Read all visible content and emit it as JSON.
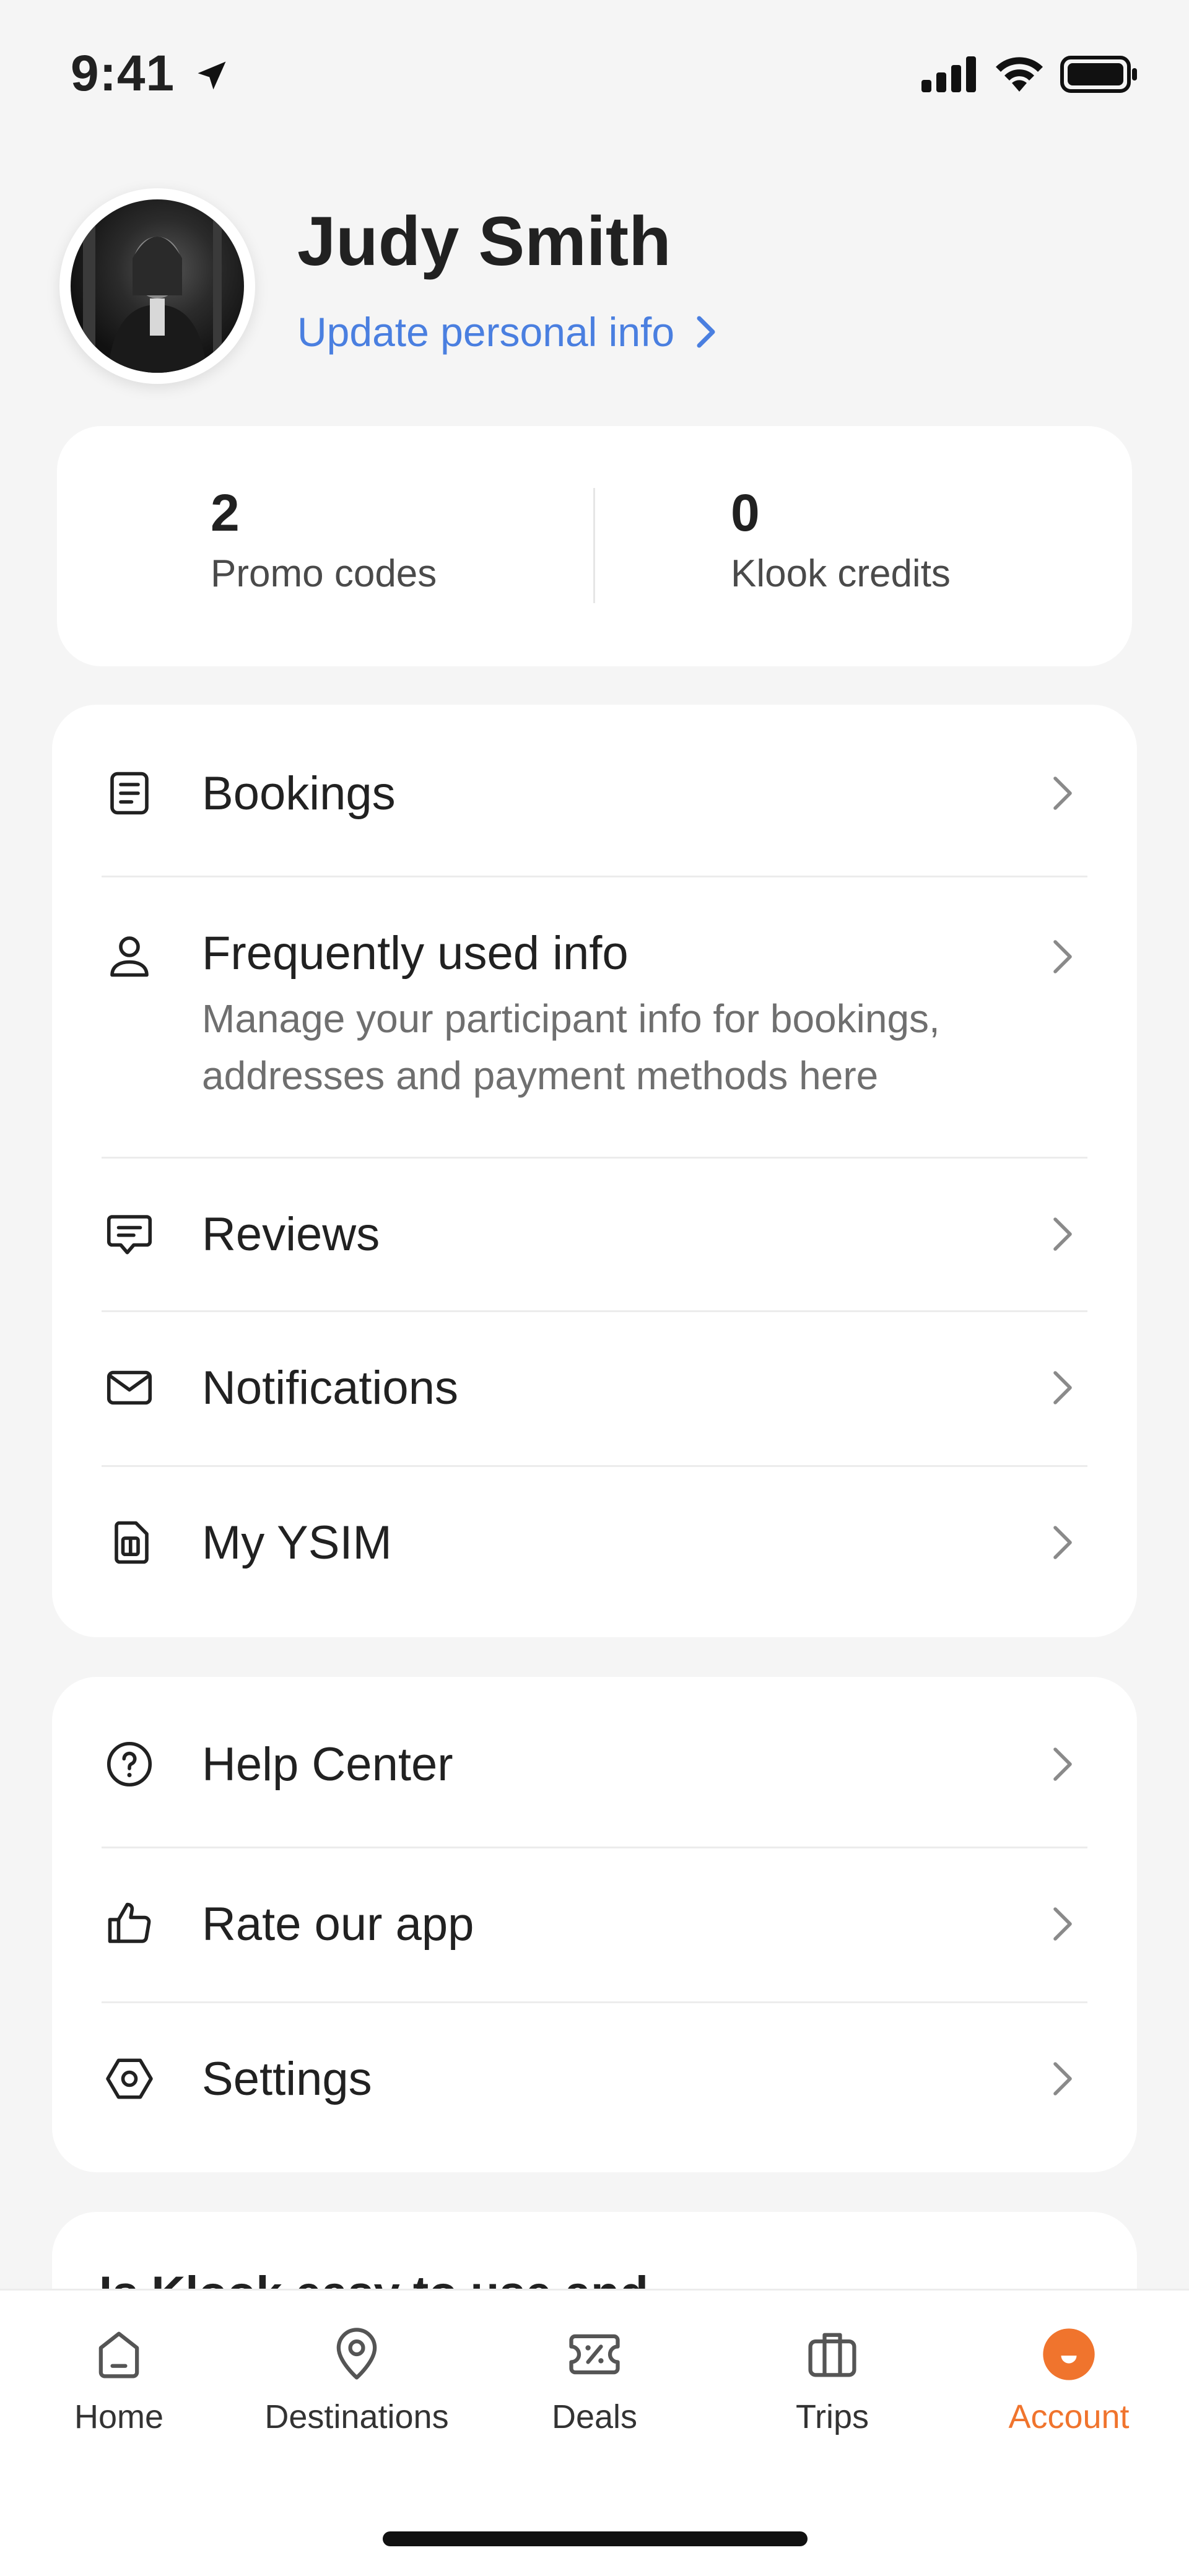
{
  "status_bar": {
    "time": "9:41"
  },
  "profile": {
    "name": "Judy Smith",
    "update_link": "Update personal info"
  },
  "stats": [
    {
      "value": "2",
      "label": "Promo codes"
    },
    {
      "value": "0",
      "label": "Klook credits"
    }
  ],
  "menu_primary": [
    {
      "label": "Bookings",
      "icon": "document-icon"
    },
    {
      "label": "Frequently used info",
      "subtitle": "Manage your participant info for bookings,\naddresses and payment methods here",
      "icon": "person-icon"
    },
    {
      "label": "Reviews",
      "icon": "chat-icon"
    },
    {
      "label": "Notifications",
      "icon": "envelope-icon"
    },
    {
      "label": "My YSIM",
      "icon": "sim-card-icon"
    }
  ],
  "menu_secondary": [
    {
      "label": "Help Center",
      "icon": "question-icon"
    },
    {
      "label": "Rate our app",
      "icon": "thumbs-up-icon"
    },
    {
      "label": "Settings",
      "icon": "hexagon-settings-icon"
    }
  ],
  "feedback_card": {
    "title": "Is Klook easy to use and"
  },
  "tabs": [
    {
      "label": "Home",
      "icon": "home-icon"
    },
    {
      "label": "Destinations",
      "icon": "location-pin-icon"
    },
    {
      "label": "Deals",
      "icon": "coupon-icon"
    },
    {
      "label": "Trips",
      "icon": "suitcase-icon"
    },
    {
      "label": "Account",
      "icon": "account-icon",
      "active": true
    }
  ],
  "colors": {
    "accent": "#f0742d",
    "link": "#4a7fe0"
  }
}
